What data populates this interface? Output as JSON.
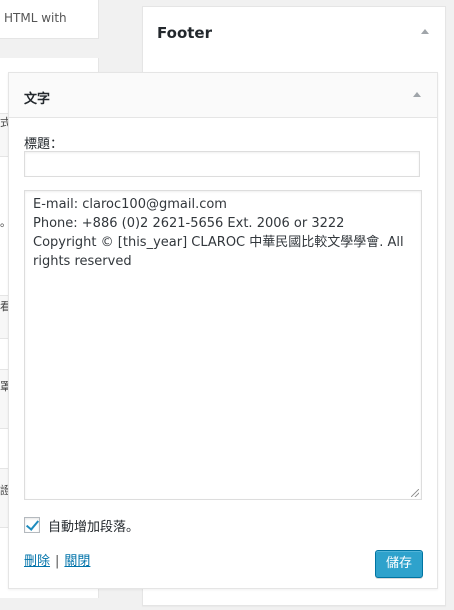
{
  "background": {
    "left_snippet": "HTML with",
    "left_glyphs": [
      "式",
      "。",
      "看",
      "罩",
      "證"
    ]
  },
  "sidebar": {
    "title": "Footer"
  },
  "widget": {
    "title": "文字",
    "title_label": "標題：",
    "title_value": "",
    "text_lines": [
      "E-mail: claroc100@gmail.com",
      "Phone: +886 (0)2 2621-5656 Ext. 2006 or 3222",
      "Copyright © [this_year] CLAROC 中華民國比較文學學會. All rights reserved"
    ],
    "autop_label": "自動增加段落。",
    "autop_checked": true,
    "delete_label": "刪除",
    "link_separator": "|",
    "close_label": "關閉",
    "save_label": "儲存"
  },
  "colors": {
    "accent": "#2ea2cc",
    "link": "#0073aa",
    "checkbox_check": "#1e8cbe"
  }
}
